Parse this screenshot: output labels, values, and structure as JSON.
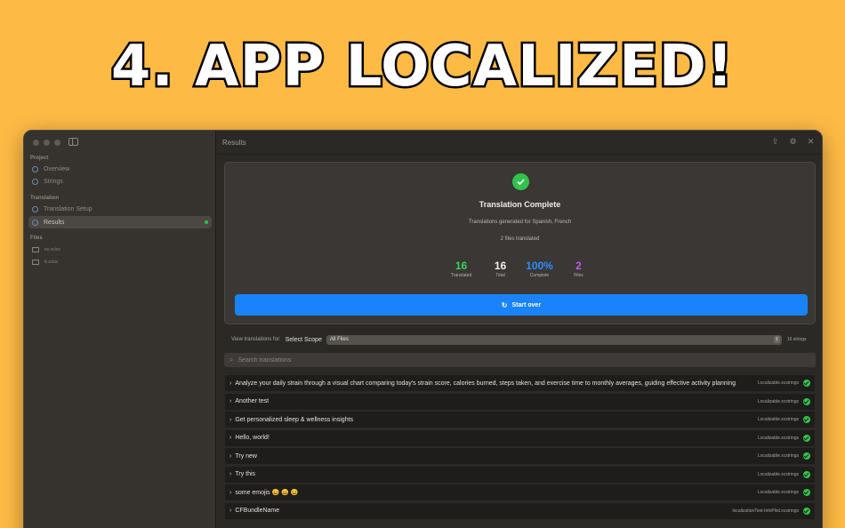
{
  "headline": "4. APP LOCALIZED!",
  "sidebar": {
    "sections": [
      {
        "label": "Project",
        "items": [
          {
            "label": "Overview"
          },
          {
            "label": "Strings"
          }
        ]
      },
      {
        "label": "Translation",
        "items": [
          {
            "label": "Translation Setup"
          },
          {
            "label": "Results",
            "active": true
          }
        ]
      },
      {
        "label": "Files",
        "items": [
          {
            "label": "es.xcloc"
          },
          {
            "label": "fr.xcloc"
          }
        ]
      }
    ]
  },
  "main": {
    "title": "Results",
    "card": {
      "title": "Translation Complete",
      "subtitle": "Translations generated for Spanish, French",
      "files_line": "2 files translated",
      "stats": [
        {
          "value": "16",
          "label": "Translated",
          "color": "#3ad35a"
        },
        {
          "value": "16",
          "label": "Total",
          "color": "#f2eeea"
        },
        {
          "value": "100%",
          "label": "Complete",
          "color": "#2d8cff"
        },
        {
          "value": "2",
          "label": "Files",
          "color": "#c15ce6"
        }
      ],
      "start_over": "Start over"
    },
    "scope": {
      "label": "View translations for:",
      "title": "Select Scope",
      "selected": "All Files",
      "count": "16 strings"
    },
    "search": {
      "placeholder": "Search translations"
    },
    "rows": [
      {
        "text": "Analyze your daily strain through a visual chart comparing today's strain score, calories burned, steps taken, and exercise time to monthly averages, guiding effective activity planning",
        "file": "Localizable.xcstrings"
      },
      {
        "text": "Another test",
        "file": "Localizable.xcstrings"
      },
      {
        "text": "Get personalized sleep & wellness insights",
        "file": "Localizable.xcstrings"
      },
      {
        "text": "Hello, world!",
        "file": "Localizable.xcstrings"
      },
      {
        "text": "Try new",
        "file": "Localizable.xcstrings"
      },
      {
        "text": "Try this",
        "file": "Localizable.xcstrings"
      },
      {
        "text": "some emojis 😀 😀 😀",
        "file": "Localizable.xcstrings"
      },
      {
        "text": "CFBundleName",
        "file": "localizationTest-InfoPlist.xcstrings"
      }
    ]
  },
  "colors": {
    "background": "#fdba45",
    "accent": "#1883fb",
    "success": "#32c24e"
  }
}
